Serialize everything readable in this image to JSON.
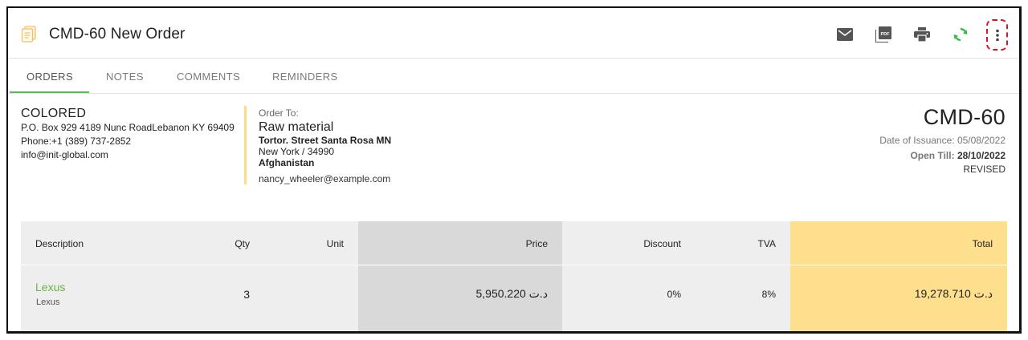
{
  "header": {
    "title": "CMD-60 New Order",
    "icons": [
      "document-icon",
      "mail-icon",
      "pdf-icon",
      "print-icon",
      "refresh-icon",
      "more-vert-icon"
    ],
    "accent_green": "#4caf50",
    "highlight_red": "#e0141e"
  },
  "tabs": [
    {
      "label": "ORDERS",
      "active": true
    },
    {
      "label": "NOTES",
      "active": false
    },
    {
      "label": "COMMENTS",
      "active": false
    },
    {
      "label": "REMINDERS",
      "active": false
    }
  ],
  "company": {
    "name": "COLORED",
    "address": "P.O. Box 929 4189 Nunc RoadLebanon KY 69409",
    "phone": "Phone:+1 (389) 737-2852",
    "email": "info@init-global.com"
  },
  "order_to": {
    "label": "Order To:",
    "name": "Raw material",
    "street": "Tortor. Street Santa Rosa MN",
    "city": "New York / 34990",
    "country": "Afghanistan",
    "email": "nancy_wheeler@example.com"
  },
  "order_info": {
    "code": "CMD-60",
    "issuance": "Date of Issuance: 05/08/2022",
    "open_till_label": "Open Till:",
    "open_till_value": "28/10/2022",
    "status": "REVISED"
  },
  "table": {
    "headers": {
      "description": "Description",
      "qty": "Qty",
      "unit": "Unit",
      "price": "Price",
      "discount": "Discount",
      "tva": "TVA",
      "total": "Total"
    },
    "rows": [
      {
        "name": "Lexus",
        "sub": "Lexus",
        "qty": "3",
        "unit": "",
        "price": "د.ت 5,950.220",
        "discount": "0%",
        "tva": "8%",
        "total": "د.ت 19,278.710"
      }
    ],
    "colors": {
      "base": "#eeeeee",
      "price_col": "#d9d9d9",
      "total_col": "#fddf8d"
    }
  }
}
